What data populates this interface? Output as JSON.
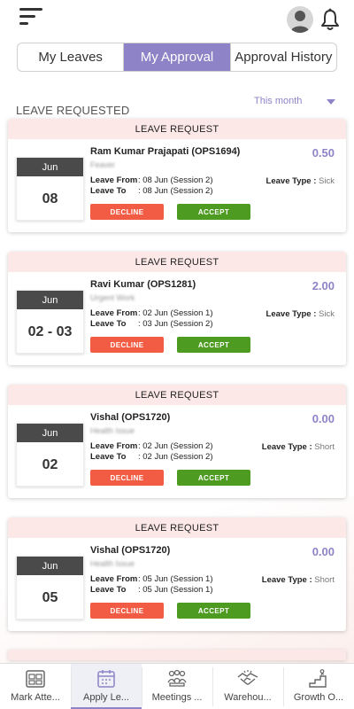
{
  "header": {
    "menu_icon": "hamburger-menu-icon",
    "avatar_icon": "user-avatar-icon",
    "bell_icon": "notification-bell-icon"
  },
  "tabs": [
    {
      "label": "My Leaves",
      "active": false
    },
    {
      "label": "My Approval",
      "active": true
    },
    {
      "label": "Approval History",
      "active": false
    }
  ],
  "section_title": "LEAVE REQUESTED",
  "filter": {
    "value": "This month",
    "icon": "dropdown-caret-icon"
  },
  "requests": [
    {
      "header": "LEAVE REQUEST",
      "month": "Jun",
      "day": "08",
      "name": "Ram Kumar Prajapati (OPS1694)",
      "reason": "Feaver",
      "days": "0.50",
      "from_label": "Leave From",
      "from": ": 08 Jun (Session 2)",
      "to_label": "Leave To",
      "to": ": 08 Jun (Session 2)",
      "type_label": "Leave Type :",
      "type": "Sick",
      "decline_label": "DECLINE",
      "accept_label": "ACCEPT"
    },
    {
      "header": "LEAVE REQUEST",
      "month": "Jun",
      "day": "02 - 03",
      "name": "Ravi Kumar (OPS1281)",
      "reason": "Urgent Work",
      "days": "2.00",
      "from_label": "Leave From",
      "from": ": 02 Jun (Session 1)",
      "to_label": "Leave To",
      "to": ": 03 Jun (Session 2)",
      "type_label": "Leave Type :",
      "type": "Sick",
      "decline_label": "DECLINE",
      "accept_label": "ACCEPT"
    },
    {
      "header": "LEAVE REQUEST",
      "month": "Jun",
      "day": "02",
      "name": "Vishal (OPS1720)",
      "reason": "Health Issue",
      "days": "0.00",
      "from_label": "Leave From",
      "from": ": 02 Jun (Session 2)",
      "to_label": "Leave To",
      "to": ": 02 Jun (Session 2)",
      "type_label": "Leave Type :",
      "type": "Short",
      "decline_label": "DECLINE",
      "accept_label": "ACCEPT"
    },
    {
      "header": "LEAVE REQUEST",
      "month": "Jun",
      "day": "05",
      "name": "Vishal (OPS1720)",
      "reason": "Health Issue",
      "days": "0.00",
      "from_label": "Leave From",
      "from": ": 05 Jun (Session 1)",
      "to_label": "Leave To",
      "to": ": 05 Jun (Session 1)",
      "type_label": "Leave Type :",
      "type": "Short",
      "decline_label": "DECLINE",
      "accept_label": "ACCEPT"
    }
  ],
  "bottom_nav": [
    {
      "label": "Mark Atte...",
      "icon": "attendance-calendar-icon",
      "active": false
    },
    {
      "label": "Apply Le...",
      "icon": "apply-leave-calendar-icon",
      "active": true
    },
    {
      "label": "Meetings ...",
      "icon": "meetings-people-icon",
      "active": false
    },
    {
      "label": "Warehou...",
      "icon": "handshake-icon",
      "active": false
    },
    {
      "label": "Growth O...",
      "icon": "growth-stairs-icon",
      "active": false
    }
  ],
  "colors": {
    "accent": "#8e83c6",
    "decline": "#f25c45",
    "accept": "#4e9b22",
    "card_header": "#fce8e6",
    "date_header": "#4a4a4a"
  }
}
